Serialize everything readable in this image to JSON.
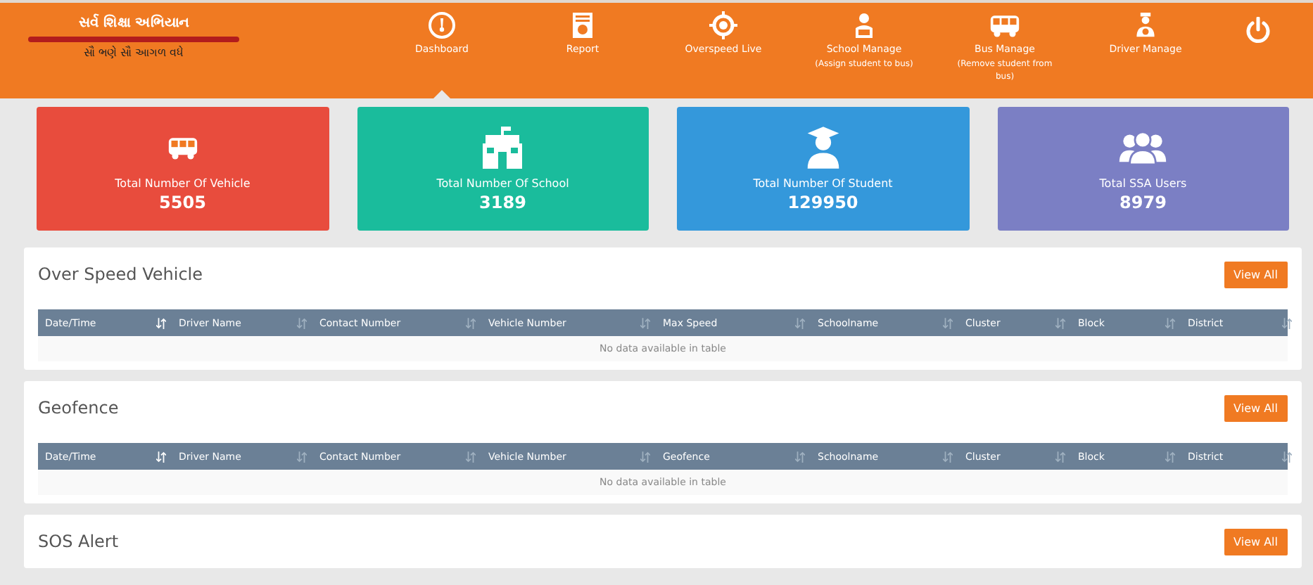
{
  "header": {
    "logo": {
      "title": "સર્વ શિક્ષા અભિયાન",
      "tagline": "સૌ ભણે સૌ આગળ વધે"
    },
    "nav": [
      {
        "kind": "dashboard",
        "label": "Dashboard",
        "selected": true
      },
      {
        "kind": "report",
        "label": "Report",
        "selected": false
      },
      {
        "kind": "target",
        "label": "Overspeed Live",
        "selected": false
      },
      {
        "kind": "reader",
        "label": "School Manage",
        "sublabel": "(Assign student to bus)",
        "selected": false
      },
      {
        "kind": "bus",
        "label": "Bus Manage",
        "sublabel": "(Remove student from bus)",
        "selected": false
      },
      {
        "kind": "driver",
        "label": "Driver Manage",
        "selected": false
      },
      {
        "kind": "power",
        "selected": false
      }
    ]
  },
  "stats": [
    {
      "kind": "bus",
      "label": "Total Number Of Vehicle",
      "value": "5505",
      "color": "#e84c3d"
    },
    {
      "kind": "school",
      "label": "Total Number Of School",
      "value": "3189",
      "color": "#1abc9c"
    },
    {
      "kind": "student",
      "label": "Total Number Of Student",
      "value": "129950",
      "color": "#3498db"
    },
    {
      "kind": "users",
      "label": "Total SSA Users",
      "value": "8979",
      "color": "#7b7fc4"
    }
  ],
  "panels": [
    {
      "title": "Over Speed Vehicle",
      "button": "View All",
      "table": {
        "columns": [
          {
            "label": "Date/Time",
            "sorted": true
          },
          {
            "label": "Driver Name",
            "sorted": false
          },
          {
            "label": "Contact Number",
            "sorted": false
          },
          {
            "label": "Vehicle Number",
            "sorted": false
          },
          {
            "label": "Max Speed",
            "sorted": false
          },
          {
            "label": "Schoolname",
            "sorted": false
          },
          {
            "label": "Cluster",
            "sorted": false
          },
          {
            "label": "Block",
            "sorted": false
          },
          {
            "label": "District",
            "sorted": false
          }
        ],
        "empty": "No data available in table"
      }
    },
    {
      "title": "Geofence",
      "button": "View All",
      "table": {
        "columns": [
          {
            "label": "Date/Time",
            "sorted": true
          },
          {
            "label": "Driver Name",
            "sorted": false
          },
          {
            "label": "Contact Number",
            "sorted": false
          },
          {
            "label": "Vehicle Number",
            "sorted": false
          },
          {
            "label": "Geofence",
            "sorted": false
          },
          {
            "label": "Schoolname",
            "sorted": false
          },
          {
            "label": "Cluster",
            "sorted": false
          },
          {
            "label": "Block",
            "sorted": false
          },
          {
            "label": "District",
            "sorted": false
          }
        ],
        "empty": "No data available in table"
      }
    },
    {
      "title": "SOS Alert",
      "button": "View All"
    }
  ]
}
